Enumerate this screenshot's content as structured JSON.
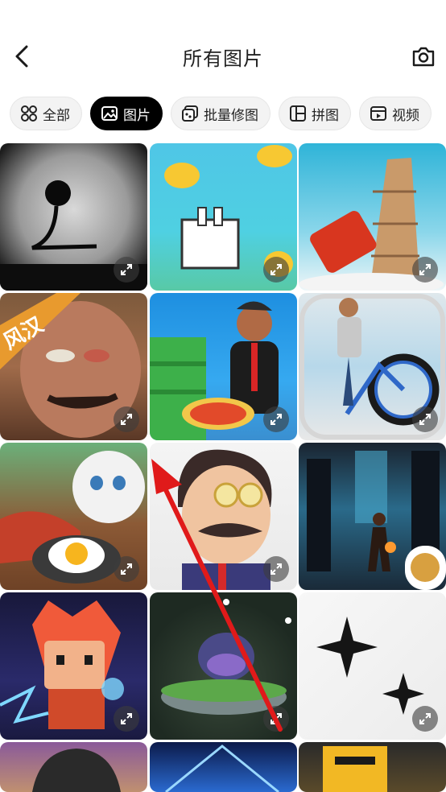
{
  "header": {
    "title": "所有图片"
  },
  "tabs": [
    {
      "label": "全部",
      "icon": "grid-icon",
      "active": false
    },
    {
      "label": "图片",
      "icon": "image-icon",
      "active": true
    },
    {
      "label": "批量修图",
      "icon": "batch-edit-icon",
      "active": false
    },
    {
      "label": "拼图",
      "icon": "collage-icon",
      "active": false
    },
    {
      "label": "视频",
      "icon": "video-icon",
      "active": false
    }
  ],
  "thumbnails": [
    {
      "overlay_text": ""
    },
    {
      "overlay_text": ""
    },
    {
      "overlay_text": ""
    },
    {
      "overlay_text": "风汉"
    },
    {
      "overlay_text": ""
    },
    {
      "overlay_text": ""
    }
  ],
  "colors": {
    "active_tab": "#000000",
    "arrow": "#e01a1a"
  }
}
